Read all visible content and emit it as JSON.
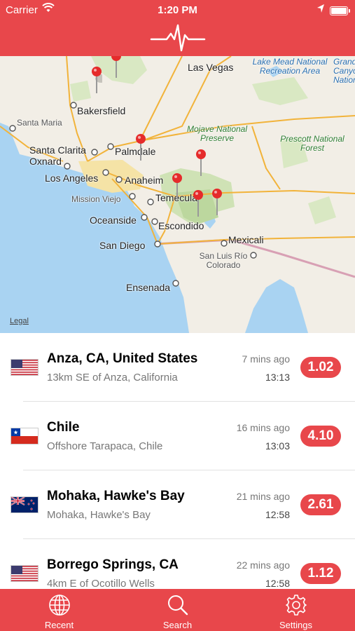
{
  "status_bar": {
    "carrier": "Carrier",
    "time": "1:20 PM"
  },
  "colors": {
    "accent": "#e8474b",
    "water": "#a9d3f2",
    "land": "#f2eee6",
    "park": "#cfe2b5"
  },
  "map": {
    "legal": "Legal",
    "labels": [
      {
        "text": "Las Vegas",
        "style": "big"
      },
      {
        "text": "Lake Mead National Recreation Area",
        "style": "blue"
      },
      {
        "text": "Grand Canyon National",
        "style": "blue"
      },
      {
        "text": "Bakersfield",
        "style": "big"
      },
      {
        "text": "Santa Maria",
        "style": "gray"
      },
      {
        "text": "Mojave National Preserve",
        "style": "green"
      },
      {
        "text": "Prescott National Forest",
        "style": "green"
      },
      {
        "text": "Santa Clarita",
        "style": "big"
      },
      {
        "text": "Palmdale",
        "style": "big"
      },
      {
        "text": "Oxnard",
        "style": "big"
      },
      {
        "text": "Los Angeles",
        "style": "big"
      },
      {
        "text": "Anaheim",
        "style": "big"
      },
      {
        "text": "Mission Viejo",
        "style": "gray"
      },
      {
        "text": "Temecula",
        "style": "big"
      },
      {
        "text": "Oceanside",
        "style": "big"
      },
      {
        "text": "Escondido",
        "style": "big"
      },
      {
        "text": "San Diego",
        "style": "big"
      },
      {
        "text": "Mexicali",
        "style": "big"
      },
      {
        "text": "San Luis Río Colorado",
        "style": "gray"
      },
      {
        "text": "Ensenada",
        "style": "big"
      }
    ]
  },
  "quakes": [
    {
      "flag": "us-flag",
      "place": "Anza, CA, United States",
      "detail": "13km SE of Anza, California",
      "ago": "7 mins ago",
      "time": "13:13",
      "magnitude": "1.02"
    },
    {
      "flag": "chile-flag",
      "place": "Chile",
      "detail": "Offshore Tarapaca, Chile",
      "ago": "16 mins ago",
      "time": "13:03",
      "magnitude": "4.10"
    },
    {
      "flag": "nz-flag",
      "place": "Mohaka, Hawke's Bay",
      "detail": "Mohaka, Hawke's Bay",
      "ago": "21 mins ago",
      "time": "12:58",
      "magnitude": "2.61"
    },
    {
      "flag": "us-flag",
      "place": "Borrego Springs, CA",
      "detail": "4km E of Ocotillo Wells",
      "ago": "22 mins ago",
      "time": "12:58",
      "magnitude": "1.12"
    }
  ],
  "tabs": [
    {
      "label": "Recent",
      "icon": "globe-icon"
    },
    {
      "label": "Search",
      "icon": "search-icon"
    },
    {
      "label": "Settings",
      "icon": "gear-icon"
    }
  ]
}
